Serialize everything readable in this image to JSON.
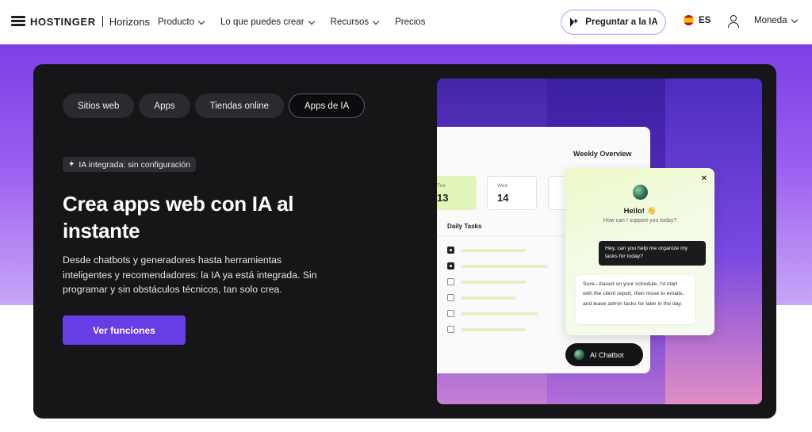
{
  "nav": {
    "brand": "HOSTINGER",
    "brand_sub": "Horizons",
    "links": [
      "Producto",
      "Lo que puedes crear",
      "Recursos",
      "Precios"
    ],
    "ask_ai": "Preguntar a la IA",
    "lang": "ES",
    "currency": "Moneda"
  },
  "hero": {
    "tabs": [
      "Sitios web",
      "Apps",
      "Tiendas online",
      "Apps de IA"
    ],
    "active_tab": "Apps de IA",
    "badge": "IA integrada: sin configuración",
    "title": "Crea apps web con IA al instante",
    "description": "Desde chatbots y generadores hasta herramientas inteligentes y recomendadores: la IA ya está integrada. Sin programar y sin obstáculos técnicos, tan solo crea.",
    "cta": "Ver funciones"
  },
  "illustration": {
    "overview_title": "Weekly Overview",
    "days": [
      {
        "name": "Tue",
        "num": "13"
      },
      {
        "name": "Wed",
        "num": "14"
      }
    ],
    "daily_tasks": "Daily Tasks",
    "tasks_done": [
      true,
      true,
      false,
      false,
      false,
      false
    ],
    "chat": {
      "close": "×",
      "hello": "Hello! 👋",
      "support": "How can I support you today?",
      "user_msg": "Hey, can you help me organize my tasks for today?",
      "bot_msg": "Sure—based on your schedule, I'd start with the client report, then move to emails, and leave admin tasks for later in the day.",
      "pill": "AI Chatbot"
    }
  },
  "colors": {
    "accent": "#673de6",
    "hero_bg": "#161618",
    "band": "#9b5cf0",
    "ask_border": "#c9a8f5"
  }
}
